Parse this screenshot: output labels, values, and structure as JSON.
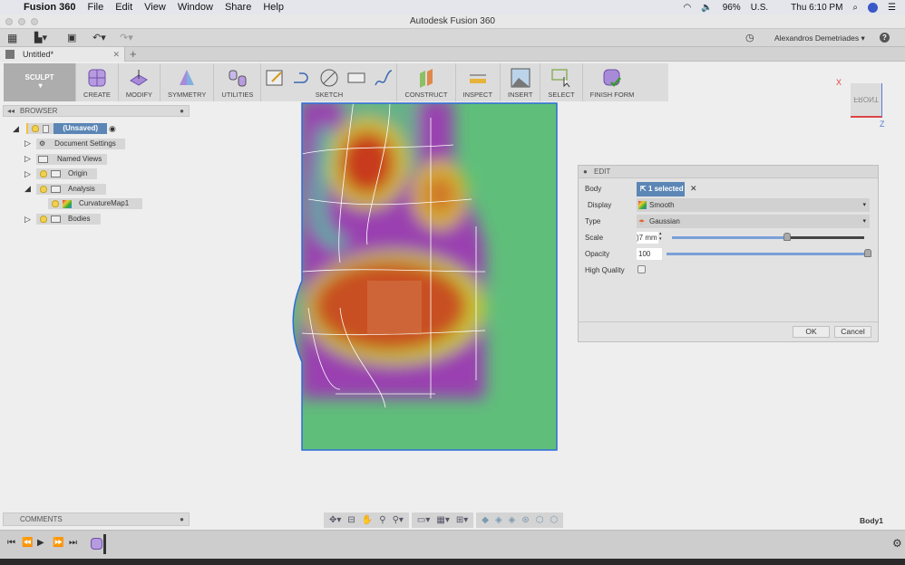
{
  "menubar": {
    "app": "Fusion 360",
    "items": [
      "File",
      "Edit",
      "View",
      "Window",
      "Share",
      "Help"
    ],
    "battery": "96%",
    "input": "U.S.",
    "clock": "Thu 6:10 PM"
  },
  "window": {
    "title": "Autodesk Fusion 360"
  },
  "account": {
    "user": "Alexandros Demetriades",
    "help": "?"
  },
  "tab": {
    "label": "Untitled*",
    "add": "+"
  },
  "ribbon": {
    "workspace": "SCULPT",
    "groups": [
      "CREATE",
      "MODIFY",
      "SYMMETRY",
      "UTILITIES",
      "SKETCH",
      "CONSTRUCT",
      "INSPECT",
      "INSERT",
      "SELECT",
      "FINISH FORM"
    ]
  },
  "browser": {
    "title": "BROWSER",
    "nodes": [
      {
        "label": "(Unsaved)"
      },
      {
        "label": "Document Settings"
      },
      {
        "label": "Named Views"
      },
      {
        "label": "Origin"
      },
      {
        "label": "Analysis"
      },
      {
        "label": "CurvatureMap1"
      },
      {
        "label": "Bodies"
      }
    ]
  },
  "viewcube": {
    "face": "FRONT",
    "x_axis": "X",
    "z_axis": "Z"
  },
  "edit": {
    "title": "EDIT",
    "body_label": "Body",
    "body_value": "1 selected",
    "display_label": "Display",
    "display_value": "Smooth",
    "type_label": "Type",
    "type_value": "Gaussian",
    "scale_label": "Scale",
    "scale_value": ")7 mm",
    "scale_level": 0.6,
    "opacity_label": "Opacity",
    "opacity_value": "100",
    "opacity_level": 1.0,
    "hq_label": "High Quality",
    "hq_checked": false,
    "ok": "OK",
    "cancel": "Cancel"
  },
  "comments": {
    "title": "COMMENTS"
  },
  "status": {
    "selection": "Body1"
  },
  "colors": {
    "accent": "#5b86b5",
    "model_green": "#5fbf7a",
    "model_purple": "#9a3fb0",
    "model_red": "#c83a1e"
  }
}
